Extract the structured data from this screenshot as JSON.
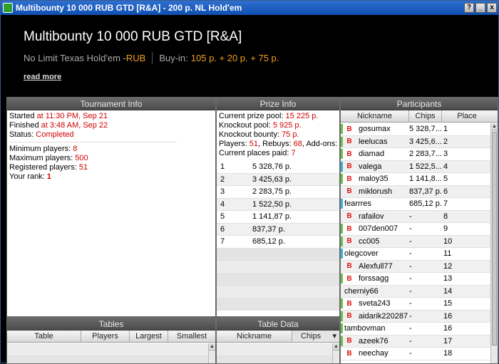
{
  "window": {
    "title": "Multibounty 10 000 RUB GTD [R&A] - 200 р. NL Hold'em",
    "btn_help": "?",
    "btn_min": "_",
    "btn_close": "x"
  },
  "header": {
    "title": "Multibounty 10 000 RUB GTD [R&A]",
    "game": "No Limit Texas Hold'em - ",
    "currency": "RUB",
    "buyin_label": "Buy-in:",
    "buyin_value": "105 р. + 20 р. + 75 р.",
    "read_more": "read more"
  },
  "tournament_info": {
    "title": "Tournament Info",
    "started_label": "Started ",
    "started_value": "at 11:30 PM, Sep 21",
    "finished_label": "Finished ",
    "finished_value": "at 3:48 AM, Sep 22",
    "status_label": "Status: ",
    "status_value": "Completed",
    "min_label": "Minimum players: ",
    "min_value": "8",
    "max_label": "Maximum players: ",
    "max_value": "500",
    "reg_label": "Registered players: ",
    "reg_value": "51",
    "rank_label": "Your rank: ",
    "rank_value": "1"
  },
  "prize_info": {
    "title": "Prize Info",
    "pool_label": "Current prize pool: ",
    "pool_value": "15 225 р.",
    "ko_label": "Knockout pool: ",
    "ko_value": "5 925 р.",
    "bounty_label": "Knockout bounty: ",
    "bounty_value": "75 р.",
    "players_label": "Players: ",
    "players_value": "51",
    "rebuys_label": ", Rebuys: ",
    "rebuys_value": "68",
    "addons_label": ", Add-ons: ",
    "addons_value": "26",
    "paid_label": "Current places paid: ",
    "paid_value": "7",
    "payouts": [
      {
        "place": "1",
        "amount": "5 328,76 р."
      },
      {
        "place": "2",
        "amount": "3 425,63 р."
      },
      {
        "place": "3",
        "amount": "2 283,75 р."
      },
      {
        "place": "4",
        "amount": "1 522,50 р."
      },
      {
        "place": "5",
        "amount": "1 141,87 р."
      },
      {
        "place": "6",
        "amount": "837,37 р."
      },
      {
        "place": "7",
        "amount": "685,12 р."
      }
    ]
  },
  "participants": {
    "title": "Participants",
    "col_nickname": "Nickname",
    "col_chips": "Chips",
    "col_place": "Place",
    "badge": "B",
    "rows": [
      {
        "nick": "gosumax",
        "chips": "5 328,7...",
        "place": "1",
        "badge": true,
        "stripe": "g"
      },
      {
        "nick": "leelucas",
        "chips": "3 425,6...",
        "place": "2",
        "badge": true,
        "stripe": "g"
      },
      {
        "nick": "diamad",
        "chips": "2 283,7...",
        "place": "3",
        "badge": true,
        "stripe": "g"
      },
      {
        "nick": "valega",
        "chips": "1 522,5...",
        "place": "4",
        "badge": true,
        "stripe": "c"
      },
      {
        "nick": "maloy35",
        "chips": "1 141,8...",
        "place": "5",
        "badge": true,
        "stripe": "g"
      },
      {
        "nick": "miklorush",
        "chips": "837,37 р.",
        "place": "6",
        "badge": true,
        "stripe": "n"
      },
      {
        "nick": "fearrres",
        "chips": "685,12 р.",
        "place": "7",
        "badge": false,
        "stripe": "c"
      },
      {
        "nick": "rafailov",
        "chips": "-",
        "place": "8",
        "badge": true,
        "stripe": "n"
      },
      {
        "nick": "007den007",
        "chips": "-",
        "place": "9",
        "badge": true,
        "stripe": "g"
      },
      {
        "nick": "cc005",
        "chips": "-",
        "place": "10",
        "badge": true,
        "stripe": "g"
      },
      {
        "nick": "olegcover",
        "chips": "-",
        "place": "11",
        "badge": false,
        "stripe": "c"
      },
      {
        "nick": "Alexfull77",
        "chips": "-",
        "place": "12",
        "badge": true,
        "stripe": "n"
      },
      {
        "nick": "forssagg",
        "chips": "-",
        "place": "13",
        "badge": true,
        "stripe": "g"
      },
      {
        "nick": "cherniy66",
        "chips": "-",
        "place": "14",
        "badge": false,
        "stripe": "n"
      },
      {
        "nick": "sveta243",
        "chips": "-",
        "place": "15",
        "badge": true,
        "stripe": "g"
      },
      {
        "nick": "aidarik220287",
        "chips": "-",
        "place": "16",
        "badge": true,
        "stripe": "g"
      },
      {
        "nick": "tambovman",
        "chips": "-",
        "place": "16",
        "badge": false,
        "stripe": "g"
      },
      {
        "nick": "azeek76",
        "chips": "-",
        "place": "17",
        "badge": true,
        "stripe": "g"
      },
      {
        "nick": "neechay",
        "chips": "-",
        "place": "18",
        "badge": true,
        "stripe": "n"
      }
    ]
  },
  "tables": {
    "title": "Tables",
    "col_table": "Table",
    "col_players": "Players",
    "col_largest": "Largest",
    "col_smallest": "Smallest"
  },
  "table_data": {
    "title": "Table Data",
    "col_nickname": "Nickname",
    "col_chips": "Chips",
    "sort_arrow": "▾"
  },
  "colors": {
    "accent": "#f0a020",
    "red": "#d00000",
    "panel_head": "#555555"
  }
}
